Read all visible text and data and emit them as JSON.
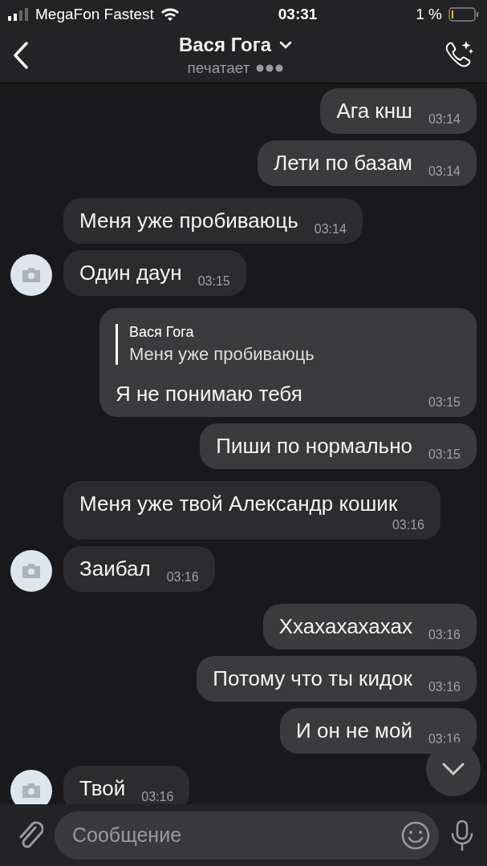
{
  "status_bar": {
    "carrier": "MegaFon Fastest",
    "time": "03:31",
    "battery": "1 %"
  },
  "header": {
    "title": "Вася Гога",
    "status": "печатает"
  },
  "messages": [
    {
      "outgoing": true,
      "text": "Ага кнш",
      "time": "03:14"
    },
    {
      "outgoing": true,
      "text": "Лети по базам",
      "time": "03:14"
    },
    {
      "outgoing": false,
      "avatar": false,
      "text": "Меня уже пробиваюць",
      "time": "03:14"
    },
    {
      "outgoing": false,
      "avatar": true,
      "text": "Один даун",
      "time": "03:15"
    },
    {
      "outgoing": true,
      "reply": {
        "author": "Вася Гога",
        "text": "Меня уже пробиваюць"
      },
      "text": "Я не понимаю тебя",
      "time": "03:15"
    },
    {
      "outgoing": true,
      "text": "Пиши по нормально",
      "time": "03:15"
    },
    {
      "outgoing": false,
      "avatar": false,
      "text": "Меня уже твой Александр кошик",
      "time": "03:16"
    },
    {
      "outgoing": false,
      "avatar": true,
      "text": "Заибал",
      "time": "03:16"
    },
    {
      "outgoing": true,
      "text": "Ххахахахахах",
      "time": "03:16"
    },
    {
      "outgoing": true,
      "text": "Потому что ты кидок",
      "time": "03:16"
    },
    {
      "outgoing": true,
      "text": "И он не мой",
      "time": "03:16"
    },
    {
      "outgoing": false,
      "avatar": true,
      "text": "Твой",
      "time": "03:16"
    }
  ],
  "composer": {
    "placeholder": "Сообщение"
  }
}
